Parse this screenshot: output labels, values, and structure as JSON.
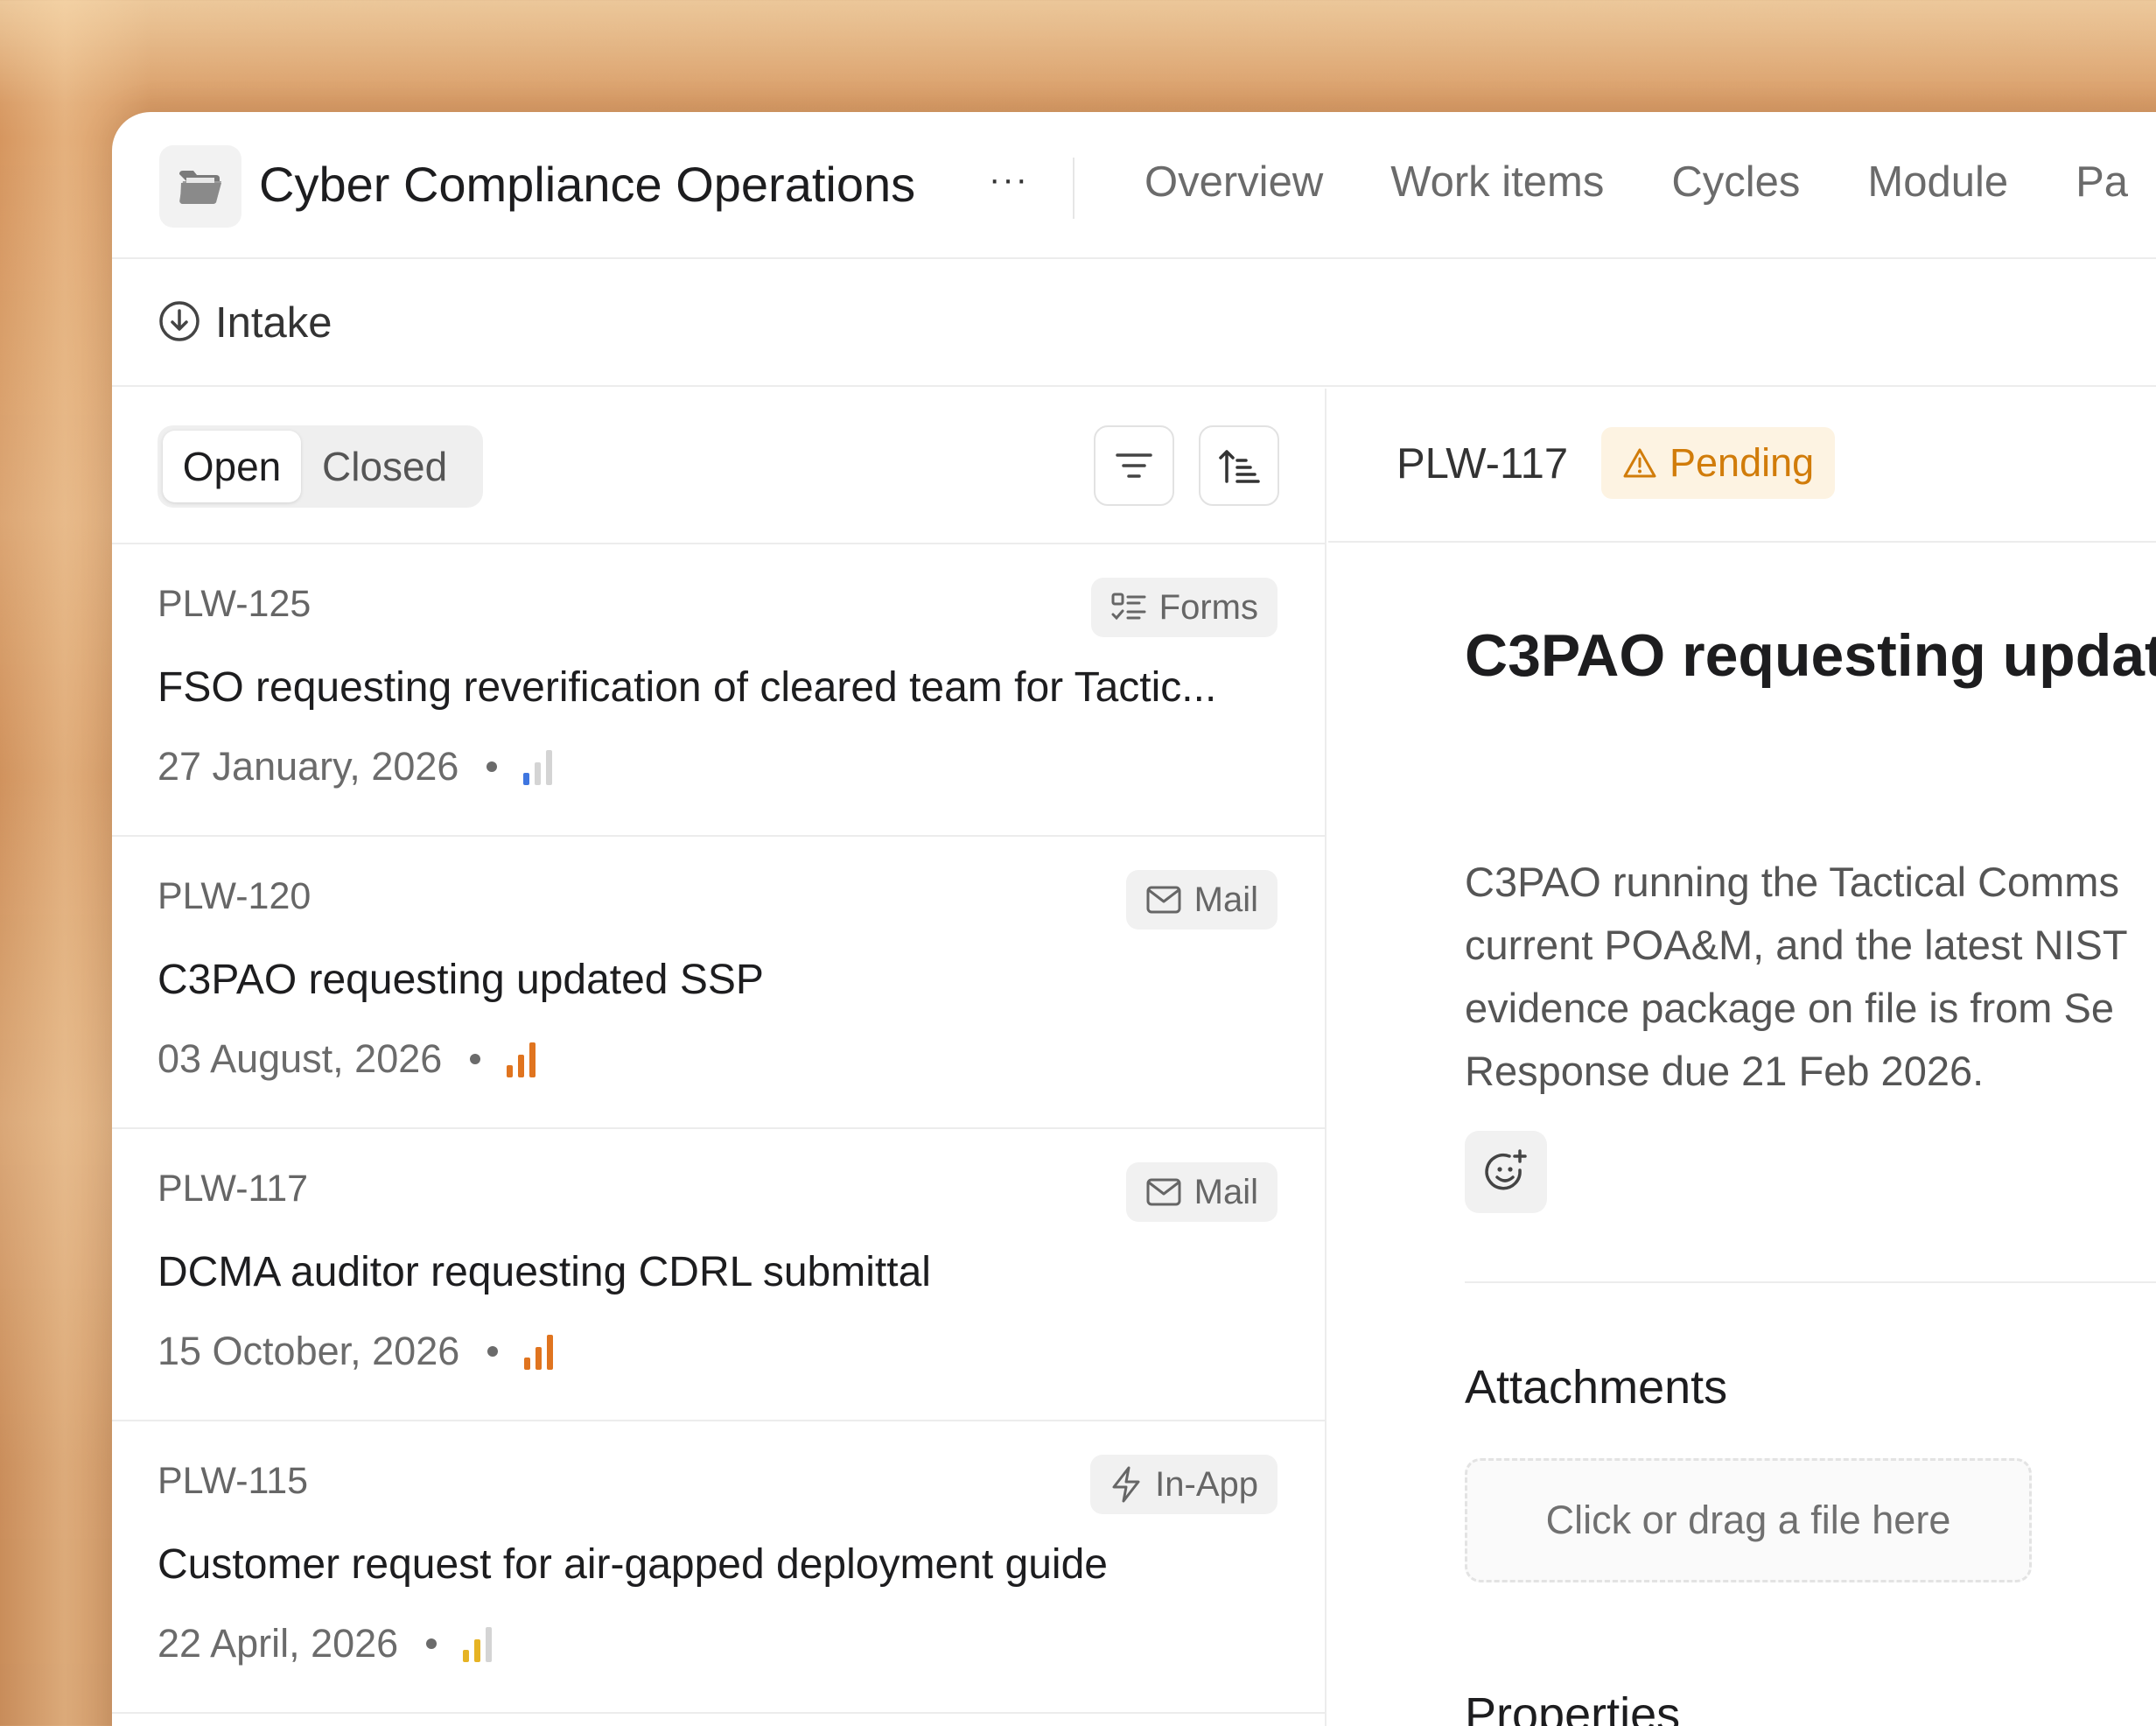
{
  "project": {
    "title": "Cyber Compliance Operations",
    "icon": "folder-icon",
    "more_label": "···"
  },
  "nav": {
    "items": [
      "Overview",
      "Work items",
      "Cycles",
      "Module",
      "Pa"
    ]
  },
  "intake": {
    "label": "Intake",
    "icon": "download-circle-icon"
  },
  "tabs": {
    "open": "Open",
    "closed": "Closed",
    "selected": "Open"
  },
  "list": {
    "items": [
      {
        "id": "PLW-125",
        "source": "Forms",
        "source_icon": "form-icon",
        "title": "FSO requesting reverification of cleared team for Tactic...",
        "date": "27 January, 2026",
        "priority": "low",
        "priority_color": "#3f76e0"
      },
      {
        "id": "PLW-120",
        "source": "Mail",
        "source_icon": "mail-icon",
        "title": "C3PAO requesting updated SSP",
        "date": "03 August, 2026",
        "priority": "high",
        "priority_color": "#e0741f"
      },
      {
        "id": "PLW-117",
        "source": "Mail",
        "source_icon": "mail-icon",
        "title": "DCMA auditor requesting CDRL submittal",
        "date": "15 October, 2026",
        "priority": "high",
        "priority_color": "#e0741f"
      },
      {
        "id": "PLW-115",
        "source": "In-App",
        "source_icon": "lightning-icon",
        "title": "Customer request for air-gapped deployment guide",
        "date": "22 April, 2026",
        "priority": "medium",
        "priority_color": "#e6b324"
      }
    ]
  },
  "detail": {
    "id": "PLW-117",
    "status": "Pending",
    "status_color": "#d17c0a",
    "title": "C3PAO requesting updat",
    "description_lines": [
      "C3PAO running the Tactical Comms",
      "current POA&M, and the latest NIST",
      "evidence package on file is from Se",
      "Response due 21 Feb 2026."
    ],
    "attachments_title": "Attachments",
    "dropzone_label": "Click or drag a file here",
    "properties_title": "Properties"
  }
}
